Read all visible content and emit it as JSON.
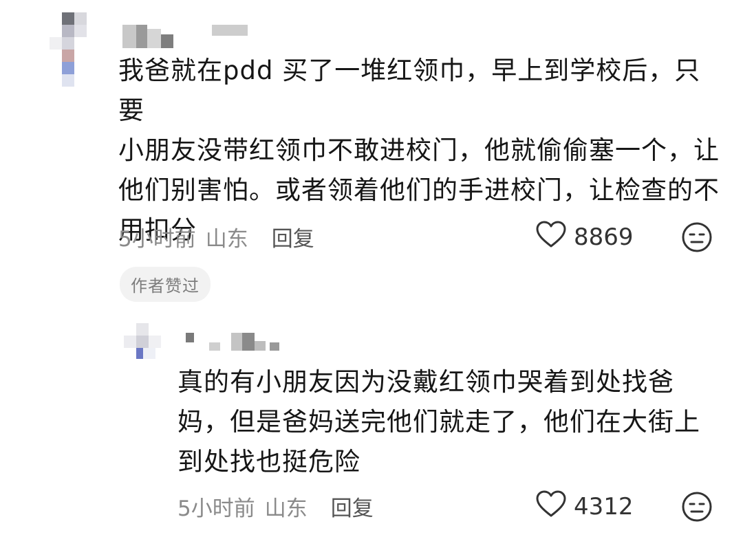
{
  "comments": [
    {
      "text": "我爸就在pdd 买了一堆红领巾，早上到学校后，只要\n小朋友没带红领巾不敢进校门，他就偷偷塞一个，让\n他们别害怕。或者领着他们的手进校门，让检查的不\n用扣分",
      "time": "5小时前",
      "location": "山东",
      "reply_label": "回复",
      "likes": "8869",
      "badge": "作者赞过"
    },
    {
      "text": "真的有小朋友因为没戴红领巾哭着到处找爸\n妈，但是爸妈送完他们就走了，他们在大街上\n到处找也挺危险",
      "time": "5小时前",
      "location": "山东",
      "reply_label": "回复",
      "likes": "4312"
    }
  ],
  "icons": {
    "like": "heart-outline-icon",
    "reaction": "neutral-face-icon"
  },
  "colors": {
    "text": "#161616",
    "meta": "#8a8a8a",
    "badge_bg": "#f2f2f2"
  }
}
